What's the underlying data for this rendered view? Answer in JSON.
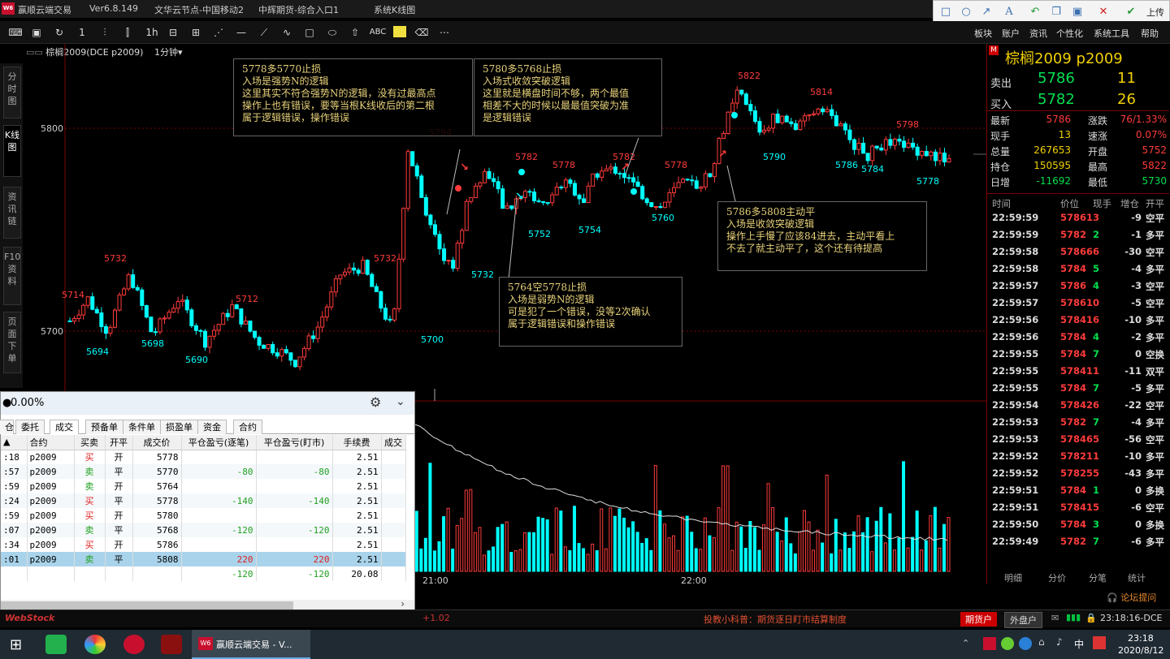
{
  "titlebar": {
    "app_name": "赢顺云端交易",
    "version": "Ver6.8.149",
    "node": "文华云节点-中国移动2",
    "broker": "中辉期货-综合入口1",
    "system": "系统K线图"
  },
  "drawbar": {
    "upload": "上传"
  },
  "toolbar": {
    "items": [
      "1",
      "1h",
      "ABC"
    ],
    "menus": [
      "板块",
      "账户",
      "资讯",
      "个性化",
      "系统工具",
      "帮助"
    ]
  },
  "chart": {
    "contract_label": "棕榈2009(DCE p2009)",
    "period": "1分钟",
    "price_labels": [
      "5800",
      "5700"
    ],
    "time_labels": [
      "21:00",
      "22:00"
    ],
    "left_rail": [
      "分时图",
      "K线图",
      "资讯链",
      "F10资料",
      "页面下单"
    ]
  },
  "notes": [
    {
      "lines": [
        "5778多5770止损",
        "入场是强势N的逻辑",
        "这里其实不符合强势N的逻辑，没有过最高点",
        "操作上也有错误，要等当根K线收后的第二根",
        "属于逻辑错误，操作错误"
      ]
    },
    {
      "lines": [
        "5780多5768止损",
        "入场式收敛突破逻辑",
        "这里就是横盘时间不够，两个最值",
        "相差不大的时候以最最值突破为准",
        "是逻辑错误"
      ]
    },
    {
      "lines": [
        "5786多5808主动平",
        "入场是收敛突破逻辑",
        "操作上手慢了应该84进去，主动平看上",
        "不去了就主动平了，这个还有待提高"
      ]
    },
    {
      "lines": [
        "5764空5778止损",
        "入场是弱势N的逻辑",
        "可是犯了一个错误，没等2次确认",
        "属于逻辑错误和操作错误"
      ]
    }
  ],
  "quote": {
    "name": "棕榈2009  p2009",
    "sell": {
      "label": "卖出",
      "price": "5786",
      "vol": "11"
    },
    "buy": {
      "label": "买入",
      "price": "5782",
      "vol": "26"
    },
    "rows": [
      {
        "l1": "最新",
        "v1": "5786",
        "l2": "涨跌",
        "v2": "76/1.33%"
      },
      {
        "l1": "现手",
        "v1": "13",
        "l2": "速涨",
        "v2": "0.07%"
      },
      {
        "l1": "总量",
        "v1": "267653",
        "l2": "开盘",
        "v2": "5752"
      },
      {
        "l1": "持仓",
        "v1": "150595",
        "l2": "最高",
        "v2": "5822"
      },
      {
        "l1": "日增",
        "v1": "-11692",
        "l2": "最低",
        "v2": "5730"
      }
    ],
    "tick_headers": [
      "时间",
      "价位",
      "现手",
      "增仓",
      "开平"
    ],
    "ticks": [
      [
        "22:59:59",
        "5786",
        "13",
        "-9",
        "空平"
      ],
      [
        "22:59:59",
        "5782",
        "2",
        "-1",
        "多平"
      ],
      [
        "22:59:58",
        "5786",
        "66",
        "-30",
        "空平"
      ],
      [
        "22:59:58",
        "5784",
        "5",
        "-4",
        "多平"
      ],
      [
        "22:59:57",
        "5786",
        "4",
        "-3",
        "空平"
      ],
      [
        "22:59:57",
        "5786",
        "10",
        "-5",
        "空平"
      ],
      [
        "22:59:56",
        "5784",
        "16",
        "-10",
        "多平"
      ],
      [
        "22:59:56",
        "5784",
        "4",
        "-2",
        "多平"
      ],
      [
        "22:59:55",
        "5784",
        "7",
        "0",
        "空换"
      ],
      [
        "22:59:55",
        "5784",
        "11",
        "-11",
        "双平"
      ],
      [
        "22:59:55",
        "5784",
        "7",
        "-5",
        "多平"
      ],
      [
        "22:59:54",
        "5784",
        "26",
        "-22",
        "空平"
      ],
      [
        "22:59:53",
        "5782",
        "7",
        "-4",
        "多平"
      ],
      [
        "22:59:53",
        "5784",
        "65",
        "-56",
        "空平"
      ],
      [
        "22:59:52",
        "5782",
        "11",
        "-10",
        "多平"
      ],
      [
        "22:59:52",
        "5782",
        "55",
        "-43",
        "多平"
      ],
      [
        "22:59:51",
        "5784",
        "1",
        "0",
        "多换"
      ],
      [
        "22:59:51",
        "5784",
        "15",
        "-6",
        "空平"
      ],
      [
        "22:59:50",
        "5784",
        "3",
        "0",
        "多换"
      ],
      [
        "22:59:49",
        "5782",
        "7",
        "-6",
        "多平"
      ]
    ],
    "tabs": [
      "明细",
      "分价",
      "分笔",
      "统计"
    ],
    "forum": "论坛提问"
  },
  "panel": {
    "percent": "0.00%",
    "tabs": [
      "委托",
      "成交",
      "预备单",
      "条件单",
      "损盈单",
      "资金",
      "合约"
    ],
    "columns": [
      "合约",
      "买卖",
      "开平",
      "成交价",
      "平仓盈亏(逐笔)",
      "平仓盈亏(盯市)",
      "手续费",
      "成交"
    ],
    "rows": [
      {
        "t": ":18",
        "c": "p2009",
        "bs": "买",
        "oc": "开",
        "px": "5778",
        "p1": "",
        "p2": "",
        "fee": "2.51"
      },
      {
        "t": ":57",
        "c": "p2009",
        "bs": "卖",
        "oc": "平",
        "px": "5770",
        "p1": "-80",
        "p2": "-80",
        "fee": "2.51"
      },
      {
        "t": ":59",
        "c": "p2009",
        "bs": "卖",
        "oc": "开",
        "px": "5764",
        "p1": "",
        "p2": "",
        "fee": "2.51"
      },
      {
        "t": ":24",
        "c": "p2009",
        "bs": "买",
        "oc": "平",
        "px": "5778",
        "p1": "-140",
        "p2": "-140",
        "fee": "2.51"
      },
      {
        "t": ":59",
        "c": "p2009",
        "bs": "买",
        "oc": "开",
        "px": "5780",
        "p1": "",
        "p2": "",
        "fee": "2.51"
      },
      {
        "t": ":07",
        "c": "p2009",
        "bs": "卖",
        "oc": "平",
        "px": "5768",
        "p1": "-120",
        "p2": "-120",
        "fee": "2.51"
      },
      {
        "t": ":34",
        "c": "p2009",
        "bs": "买",
        "oc": "开",
        "px": "5786",
        "p1": "",
        "p2": "",
        "fee": "2.51"
      },
      {
        "t": ":01",
        "c": "p2009",
        "bs": "卖",
        "oc": "平",
        "px": "5808",
        "p1": "220",
        "p2": "220",
        "fee": "2.51"
      }
    ],
    "total": {
      "p1": "-120",
      "p2": "-120",
      "fee": "20.08"
    }
  },
  "status": {
    "news": "投教小科普：期货逐日盯市结算制度",
    "left_btn": "期货户",
    "right_btn": "外盘户",
    "clock": "23:18:16-DCE",
    "fragment": "+1.02"
  },
  "taskbar": {
    "app_label": "赢顺云端交易 - V...",
    "time": "23:18",
    "date": "2020/8/12",
    "ime": "中"
  },
  "colors": {
    "up": "#ff3b3b",
    "down": "#00ffff",
    "note": "#e8d27a",
    "accent": "#f0d000"
  }
}
